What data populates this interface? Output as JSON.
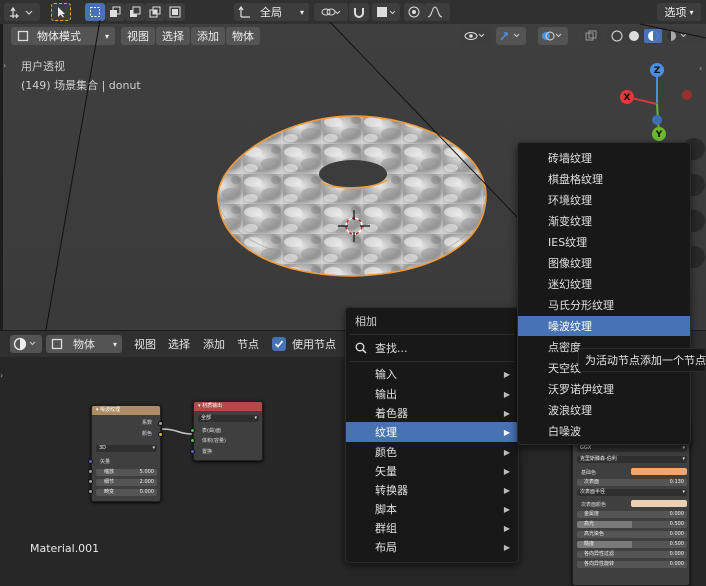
{
  "topbar": {
    "global_label": "全局",
    "options_label": "选项"
  },
  "viewport": {
    "mode_label": "物体模式",
    "menu": [
      "视图",
      "选择",
      "添加",
      "物体"
    ],
    "info_line1": "用户透视",
    "info_line2": "(149) 场景集合 | donut"
  },
  "gizmo": {
    "z": "Z",
    "x": "X",
    "y": "Y"
  },
  "node_editor": {
    "type_label": "物体",
    "menu": [
      "视图",
      "选择",
      "添加",
      "节点"
    ],
    "use_nodes_label": "使用节点",
    "material_name": "Material.001"
  },
  "noise_node": {
    "title": "噪波纹理",
    "out_fac": "系数",
    "out_color": "颜色",
    "dimension": "3D",
    "vector": "矢量",
    "scale_label": "缩放",
    "scale_value": "5.000",
    "detail_label": "细节",
    "detail_value": "2.000",
    "distortion_label": "畸变",
    "distortion_value": "0.000"
  },
  "output_node": {
    "title": "材质输出",
    "target": "全部",
    "in_surface": "表(曲)面",
    "in_volume": "体积(容量)",
    "in_displacement": "置换"
  },
  "bsdf_panel": {
    "distribution": "GGX",
    "subsurface_method": "克里斯滕森-伯利",
    "base_color": "基础色",
    "subsurface": "次表面",
    "subsurface_value": "0.130",
    "subsurface_radius": "次表面半径",
    "subsurface_color": "次表面颜色",
    "metallic": "金属度",
    "metallic_value": "0.000",
    "specular": "高光",
    "specular_value": "0.500",
    "specular_tint": "高光染色",
    "specular_tint_value": "0.000",
    "roughness": "糙度",
    "roughness_value": "0.500",
    "anisotropic": "各向异性过滤",
    "anisotropic_value": "0.000",
    "anisotropic_rotation": "各向异性旋转",
    "anisotropic_rotation_value": "0.000"
  },
  "add_menu": {
    "title": "相加",
    "search": "查找...",
    "items": [
      "输入",
      "输出",
      "着色器",
      "纹理",
      "颜色",
      "矢量",
      "转换器",
      "脚本",
      "群组",
      "布局"
    ]
  },
  "texture_menu": {
    "items": [
      "砖墙纹理",
      "棋盘格纹理",
      "环境纹理",
      "渐变纹理",
      "IES纹理",
      "图像纹理",
      "迷幻纹理",
      "马氏分形纹理",
      "噪波纹理",
      "点密度",
      "天空纹",
      "沃罗诺伊纹理",
      "波浪纹理",
      "白噪波"
    ]
  },
  "tooltip": {
    "text": "为活动节点添加一个节点."
  },
  "colors": {
    "highlight": "#4772b3",
    "texture_node_header": "#ad8c66",
    "output_node_header": "#b24a4a",
    "selection_orange": "#f29a38"
  }
}
